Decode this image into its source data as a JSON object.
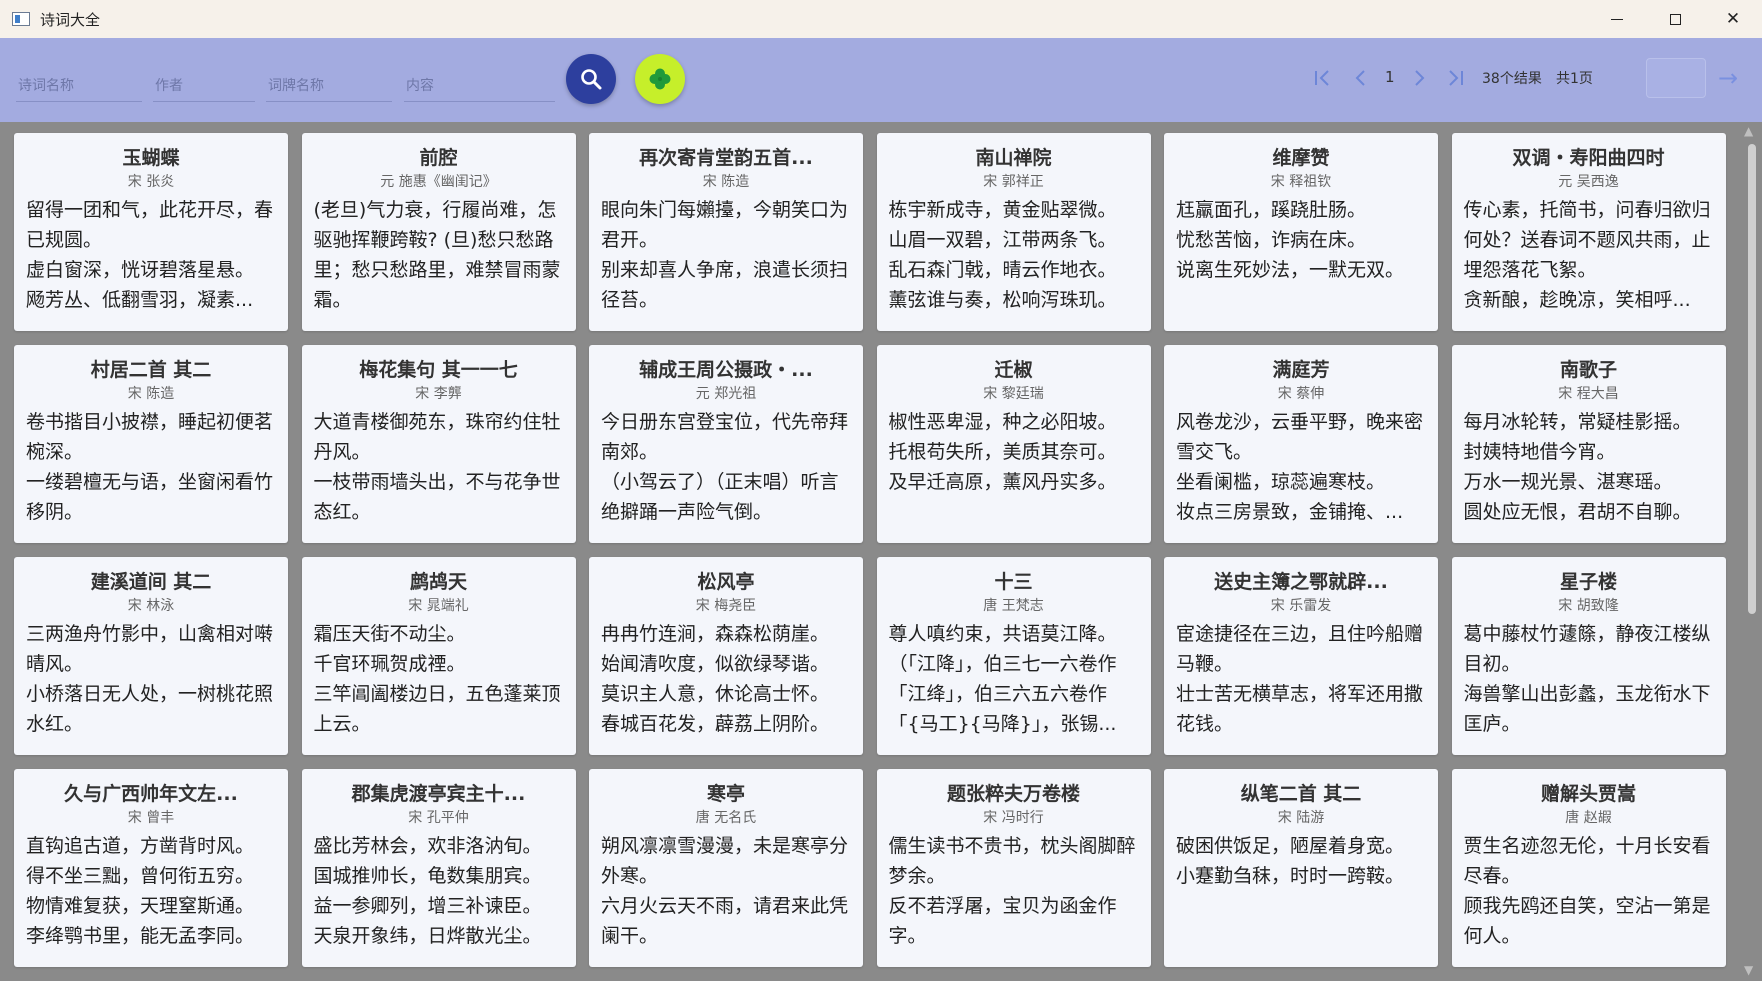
{
  "window": {
    "title": "诗词大全"
  },
  "search": {
    "title_placeholder": "诗词名称",
    "author_placeholder": "作者",
    "cipai_placeholder": "词牌名称",
    "content_placeholder": "内容"
  },
  "pager": {
    "page": "1",
    "result_count": "38个结果",
    "total_pages": "共1页",
    "jump_value": ""
  },
  "colors": {
    "toolbar": "#a3abe0",
    "search_btn": "#2d3f9e",
    "random_btn": "#c6ef2a"
  },
  "cards": [
    {
      "title": "玉蝴蝶",
      "author": "宋 张炎",
      "content": "留得一团和气，此花开尽，春已规圆。\n虚白窗深，恍讶碧落星悬。\n飏芳丛、低翻雪羽，凝素..."
    },
    {
      "title": "前腔",
      "author": "元 施惠《幽闺记》",
      "content": "(老旦)气力衰，行履尚难，怎驱驰挥鞭跨鞍? (旦)愁只愁路里；愁只愁路里，难禁冒雨蒙霜。"
    },
    {
      "title": "再次寄肯堂韵五首...",
      "author": "宋 陈造",
      "content": "眼向朱门每嬾擡，今朝笑口为君开。\n别来却喜人争席，浪遣长须扫径苔。"
    },
    {
      "title": "南山禅院",
      "author": "宋 郭祥正",
      "content": "栋宇新成寺，黄金贴翠微。\n山眉一双碧，江带两条飞。\n乱石森门戟，晴云作地衣。\n薰弦谁与奏，松响泻珠玑。"
    },
    {
      "title": "维摩赞",
      "author": "宋 释祖钦",
      "content": "尪羸面孔，蹊跷肚肠。\n忧愁苦恼，诈病在床。\n说离生死妙法，一默无双。"
    },
    {
      "title": "双调・寿阳曲四时",
      "author": "元 吴西逸",
      "content": "传心素，托简书，问春归欲归何处？送春词不题风共雨，止埋怨落花飞絮。\n贪新酿，趁晚凉，笑相呼..."
    },
    {
      "title": "村居二首 其二",
      "author": "宋 陈造",
      "content": "卷书揩目小披襟，睡起初便茗椀深。\n一缕碧檀无与语，坐窗闲看竹移阴。"
    },
    {
      "title": "梅花集句 其一一七",
      "author": "宋 李龏",
      "content": "大道青楼御苑东，珠帘约住牡丹风。\n一枝带雨墙头出，不与花争世态红。"
    },
    {
      "title": "辅成王周公摄政・...",
      "author": "元 郑光祖",
      "content": "今日册东宫登宝位，代先帝拜南郊。\n（小驾云了）（正末唱）听言绝擗踊一声险气倒。"
    },
    {
      "title": "迁椒",
      "author": "宋 黎廷瑞",
      "content": "椒性恶卑湿，种之必阳坡。\n托根苟失所，美质其奈可。\n及早迁高原，薰风丹实多。"
    },
    {
      "title": "满庭芳",
      "author": "宋 蔡伸",
      "content": "风卷龙沙，云垂平野，晚来密雪交飞。\n坐看阑槛，琼蕊遍寒枝。\n妆点三房景致，金铺掩、..."
    },
    {
      "title": "南歌子",
      "author": "宋 程大昌",
      "content": "每月冰轮转，常疑桂影摇。\n封姨特地借今宵。\n万水一规光景、湛寒瑶。\n圆处应无恨，君胡不自聊。"
    },
    {
      "title": "建溪道间 其二",
      "author": "宋 林泳",
      "content": "三两渔舟竹影中，山禽相对啭晴风。\n小桥落日无人处，一树桃花照水红。"
    },
    {
      "title": "鹧鸪天",
      "author": "宋 晁端礼",
      "content": "霜压天街不动尘。\n千官环珮贺成禋。\n三竿阊阖楼边日，五色蓬莱顶上云。"
    },
    {
      "title": "松风亭",
      "author": "宋 梅尧臣",
      "content": "冉冉竹连涧，森森松荫崖。\n始闻清吹度，似欲绿琴谐。\n莫识主人意，休论高士怀。\n春城百花发，薜荔上阴阶。"
    },
    {
      "title": "十三",
      "author": "唐 王梵志",
      "content": "尊人嗔约束，共语莫江降。\n（「江降」，伯三七一六卷作「江绛」，伯三六五六卷作「{马工}{马降}」，张锡..."
    },
    {
      "title": "送史主簿之鄂就辟...",
      "author": "宋 乐雷发",
      "content": "宦途捷径在三边，且住吟船赠马鞭。\n壮士苦无横草志，将军还用撒花钱。"
    },
    {
      "title": "星子楼",
      "author": "宋 胡致隆",
      "content": "葛中藤杖竹蘧篨，静夜江楼纵目初。\n海兽擎山出彭蠡，玉龙衔水下匡庐。"
    },
    {
      "title": "久与广西帅年文左...",
      "author": "宋 曾丰",
      "content": "直钩追古道，方凿背时风。\n得不坐三黜，曾何衔五穷。\n物情难复获，天理窒斯通。\n李绛鹗书里，能无孟李同。"
    },
    {
      "title": "郡集虎渡亭宾主十...",
      "author": "宋 孔平仲",
      "content": "盛比芳林会，欢非洛汭旬。\n国城推帅长，龟数集朋宾。\n益一参卿列，增三补谏臣。\n天泉开象纬，日烨散光尘。"
    },
    {
      "title": "寒亭",
      "author": "唐 无名氏",
      "content": "朔风凛凛雪漫漫，未是寒亭分外寒。\n六月火云天不雨，请君来此凭阑干。"
    },
    {
      "title": "题张粹夫万卷楼",
      "author": "宋 冯时行",
      "content": "儒生读书不贵书，枕头阁脚醉梦余。\n反不若浮屠，宝贝为函金作字。"
    },
    {
      "title": "纵笔二首 其二",
      "author": "宋 陆游",
      "content": "破困供饭足，陋屋着身宽。\n小蹇勤刍秣，时时一跨鞍。"
    },
    {
      "title": "赠解头贾嵩",
      "author": "唐 赵嘏",
      "content": "贾生名迹忽无伦，十月长安看尽春。\n顾我先鸥还自笑，空沾一第是何人。"
    }
  ]
}
